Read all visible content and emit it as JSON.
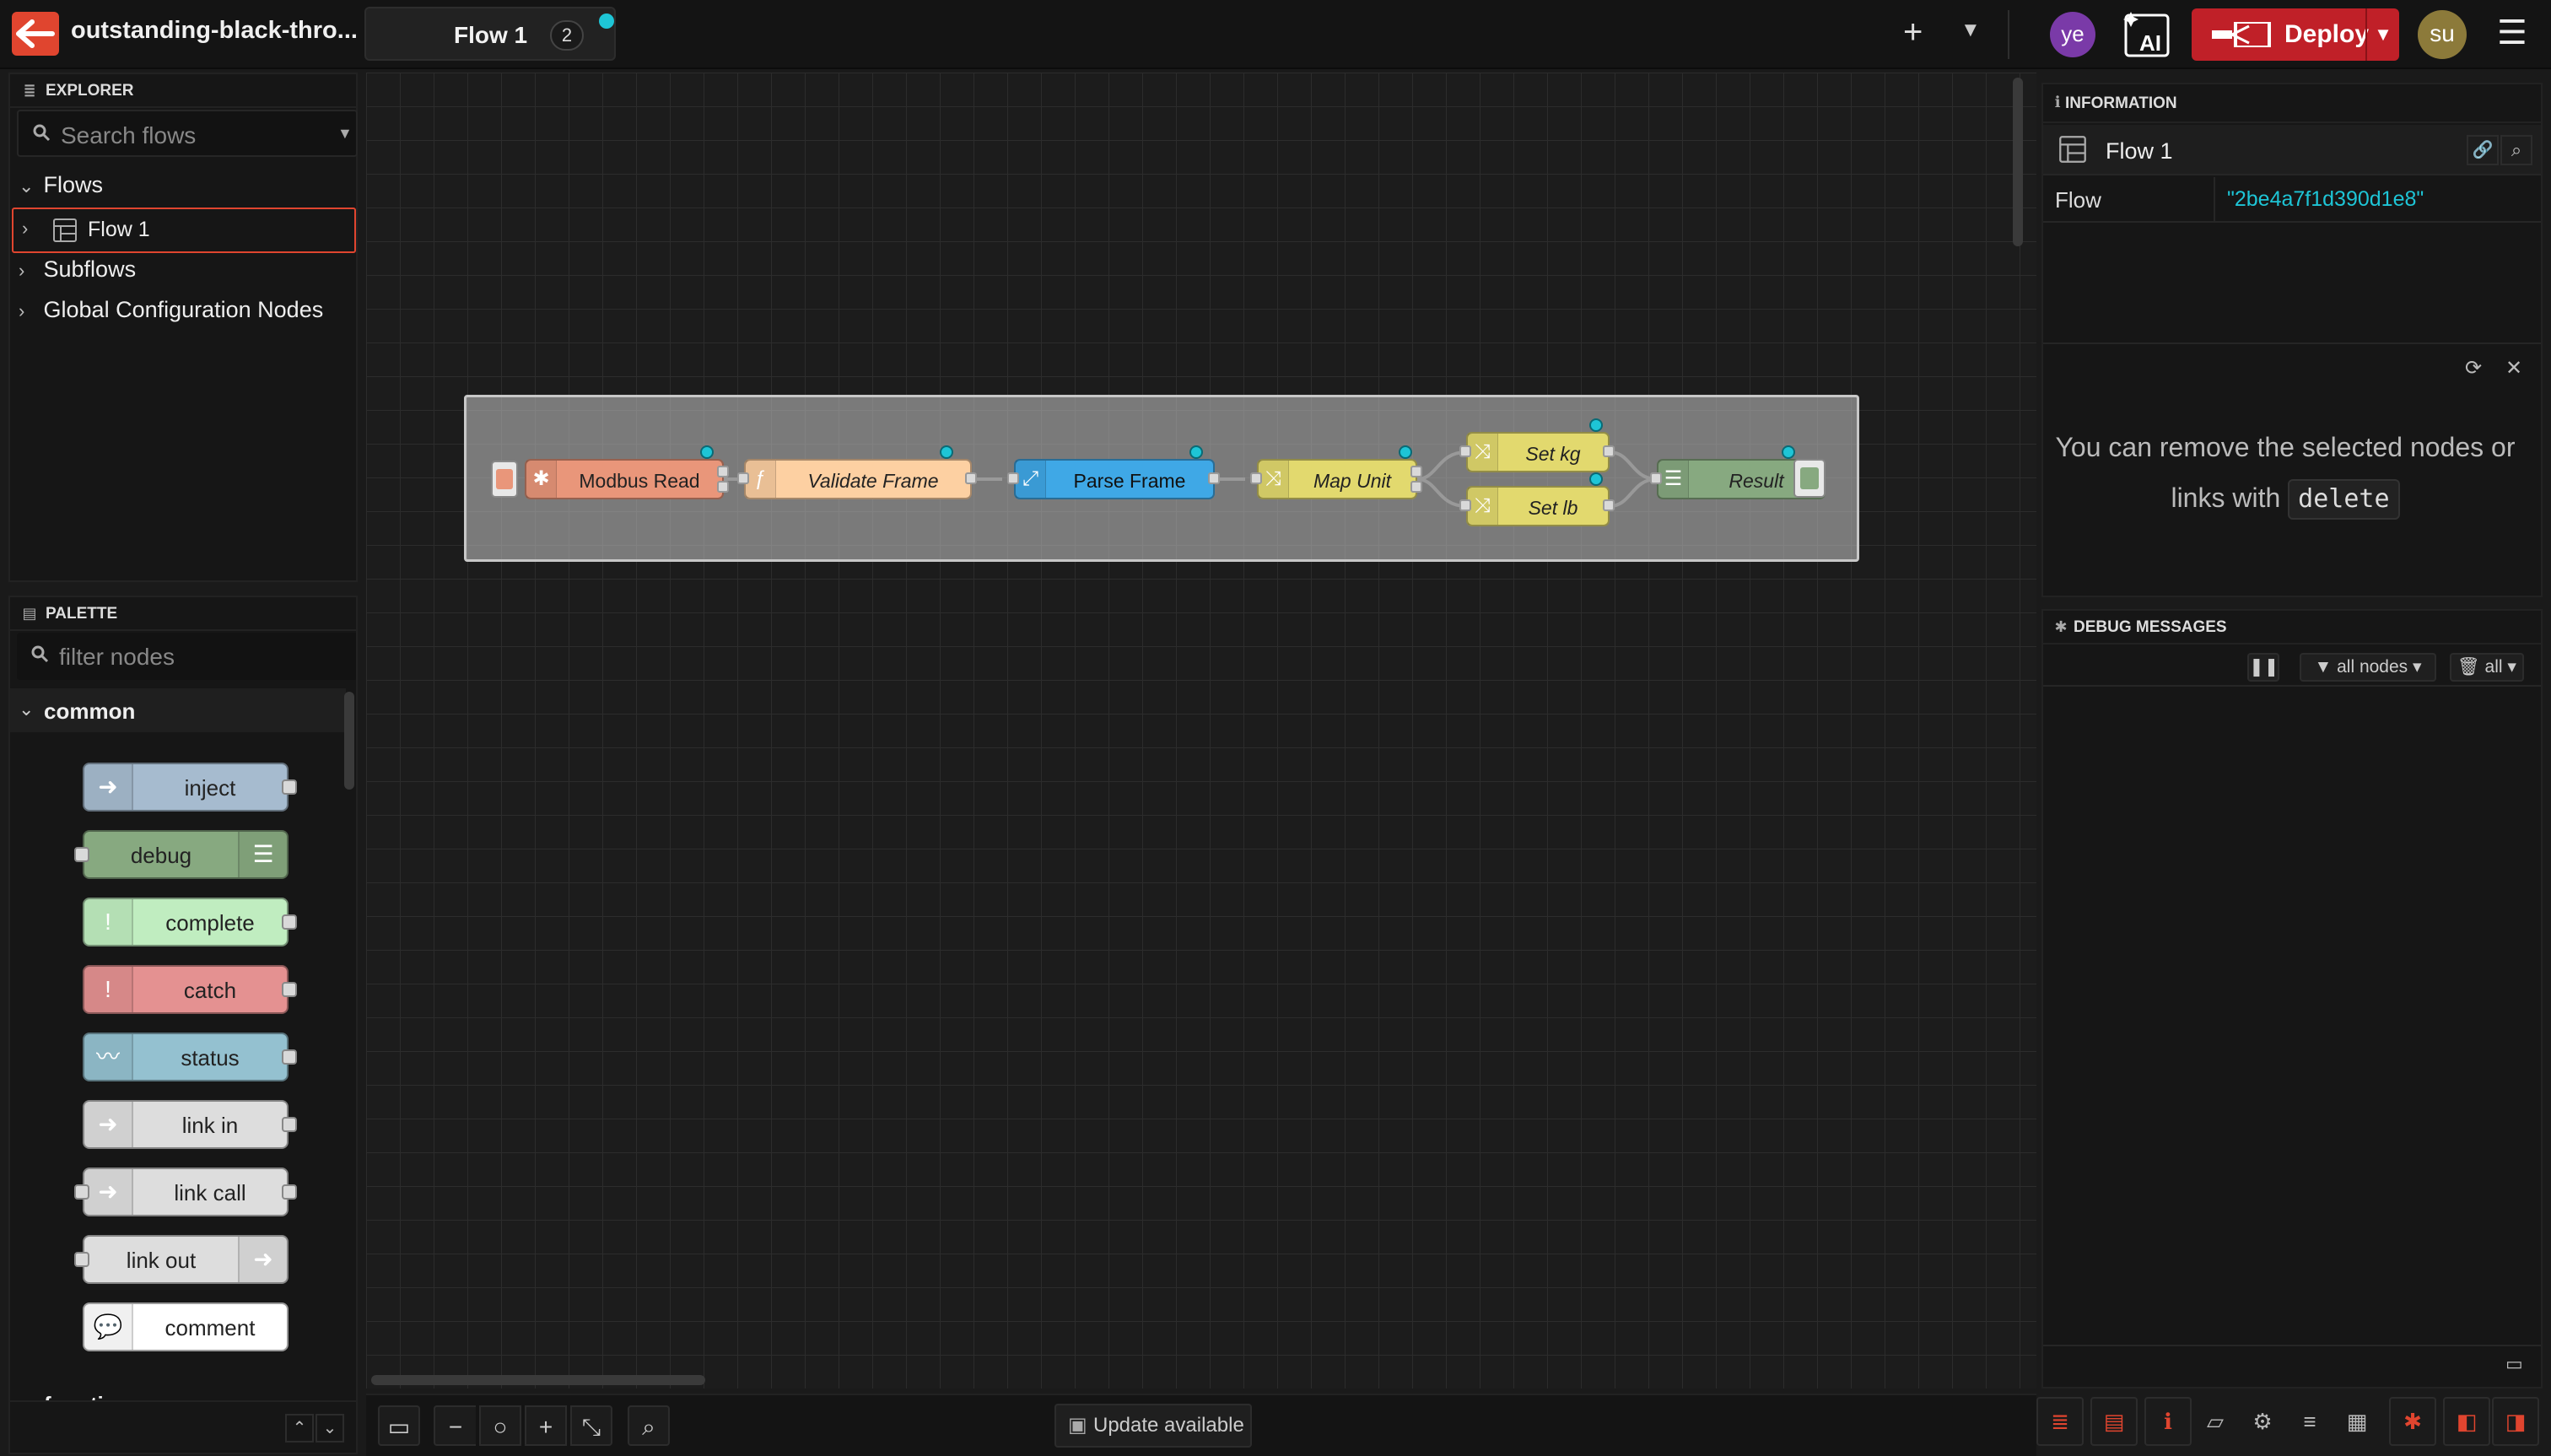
{
  "header": {
    "app_title": "outstanding-black-thro...",
    "tab_label": "Flow 1",
    "tab_badge": "2",
    "avatar_left": "ye",
    "ai_label": "AI",
    "deploy_label": "Deploy",
    "avatar_right": "su"
  },
  "explorer": {
    "title": "EXPLORER",
    "search_placeholder": "Search flows",
    "flows_label": "Flows",
    "flow_item": "Flow 1",
    "subflows_label": "Subflows",
    "global_label": "Global Configuration Nodes"
  },
  "palette": {
    "title": "PALETTE",
    "filter_placeholder": "filter nodes",
    "category": "common",
    "next_category": "function",
    "nodes": [
      {
        "label": "inject",
        "color": "#a6bbcf"
      },
      {
        "label": "debug",
        "color": "#87a980"
      },
      {
        "label": "complete",
        "color": "#c0edc0"
      },
      {
        "label": "catch",
        "color": "#e49191"
      },
      {
        "label": "status",
        "color": "#94c1d0"
      },
      {
        "label": "link in",
        "color": "#dddddd"
      },
      {
        "label": "link call",
        "color": "#dddddd"
      },
      {
        "label": "link out",
        "color": "#dddddd"
      },
      {
        "label": "comment",
        "color": "#ffffff"
      }
    ]
  },
  "canvas": {
    "nodes": [
      {
        "label": "Modbus Read",
        "color": "#e9967a"
      },
      {
        "label": "Validate Frame",
        "color": "#fdd0a2"
      },
      {
        "label": "Parse Frame",
        "color": "#3fa8e6"
      },
      {
        "label": "Map Unit",
        "color": "#e2d96e"
      },
      {
        "label": "Set kg",
        "color": "#e2d96e"
      },
      {
        "label": "Set lb",
        "color": "#e2d96e"
      },
      {
        "label": "Result",
        "color": "#87a980"
      }
    ]
  },
  "bottom_toolbar": {
    "update_label": "Update available"
  },
  "info_panel": {
    "title": "INFORMATION",
    "flow_name": "Flow 1",
    "row_label": "Flow",
    "row_value": "\"2be4a7f1d390d1e8\""
  },
  "help": {
    "text": "You can remove the selected nodes or links with",
    "key": "delete"
  },
  "debug_panel": {
    "title": "DEBUG MESSAGES",
    "filter_label": "all nodes",
    "clear_label": "all"
  }
}
